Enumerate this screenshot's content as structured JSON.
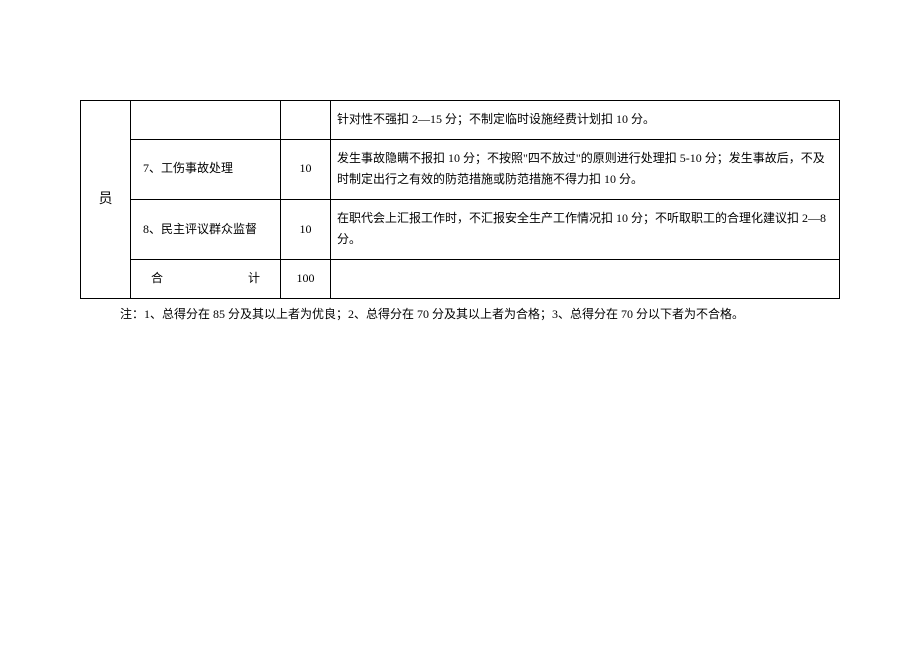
{
  "table": {
    "role_label": "员",
    "rows": [
      {
        "item": "",
        "score": "",
        "desc": "针对性不强扣 2—15 分；不制定临时设施经费计划扣 10 分。"
      },
      {
        "item": "7、工伤事故处理",
        "score": "10",
        "desc": "发生事故隐瞒不报扣 10 分；不按照\"四不放过\"的原则进行处理扣 5-10 分；发生事故后，不及时制定出行之有效的防范措施或防范措施不得力扣 10 分。"
      },
      {
        "item": "8、民主评议群众监督",
        "score": "10",
        "desc": "在职代会上汇报工作时，不汇报安全生产工作情况扣 10 分；不听取职工的合理化建议扣 2—8分。"
      }
    ],
    "total": {
      "label": "合　　　　计",
      "score": "100",
      "desc": ""
    }
  },
  "note": "注：1、总得分在 85 分及其以上者为优良；2、总得分在 70 分及其以上者为合格；3、总得分在 70 分以下者为不合格。"
}
